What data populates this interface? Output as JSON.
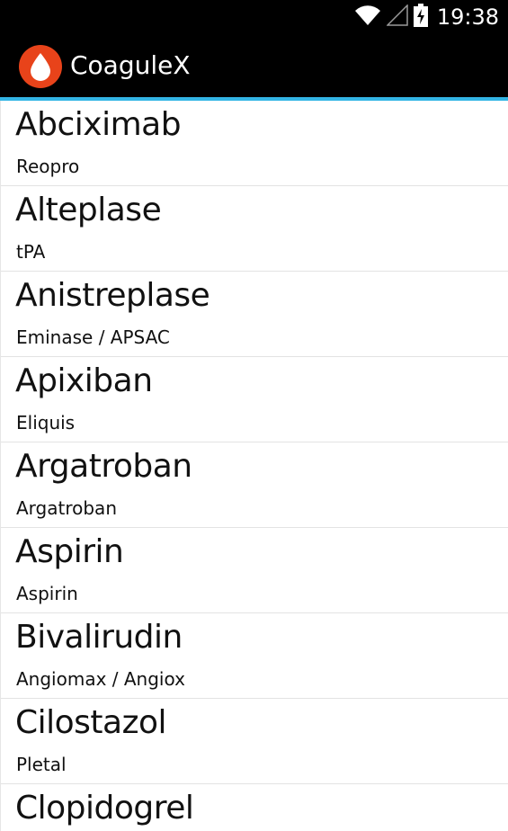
{
  "status_bar": {
    "time": "19:38",
    "icons": [
      "wifi-icon",
      "signal-icon",
      "battery-charging-icon"
    ]
  },
  "app_bar": {
    "title": "CoaguleX",
    "icon": "blood-drop-icon",
    "accent_color": "#33b5e5",
    "icon_color": "#e8431a"
  },
  "drugs": [
    {
      "name": "Abciximab",
      "brand": "Reopro"
    },
    {
      "name": "Alteplase",
      "brand": "tPA"
    },
    {
      "name": "Anistreplase",
      "brand": "Eminase / APSAC"
    },
    {
      "name": "Apixiban",
      "brand": "Eliquis"
    },
    {
      "name": "Argatroban",
      "brand": "Argatroban"
    },
    {
      "name": "Aspirin",
      "brand": "Aspirin"
    },
    {
      "name": "Bivalirudin",
      "brand": "Angiomax / Angiox"
    },
    {
      "name": "Cilostazol",
      "brand": "Pletal"
    },
    {
      "name": "Clopidogrel",
      "brand": ""
    }
  ]
}
